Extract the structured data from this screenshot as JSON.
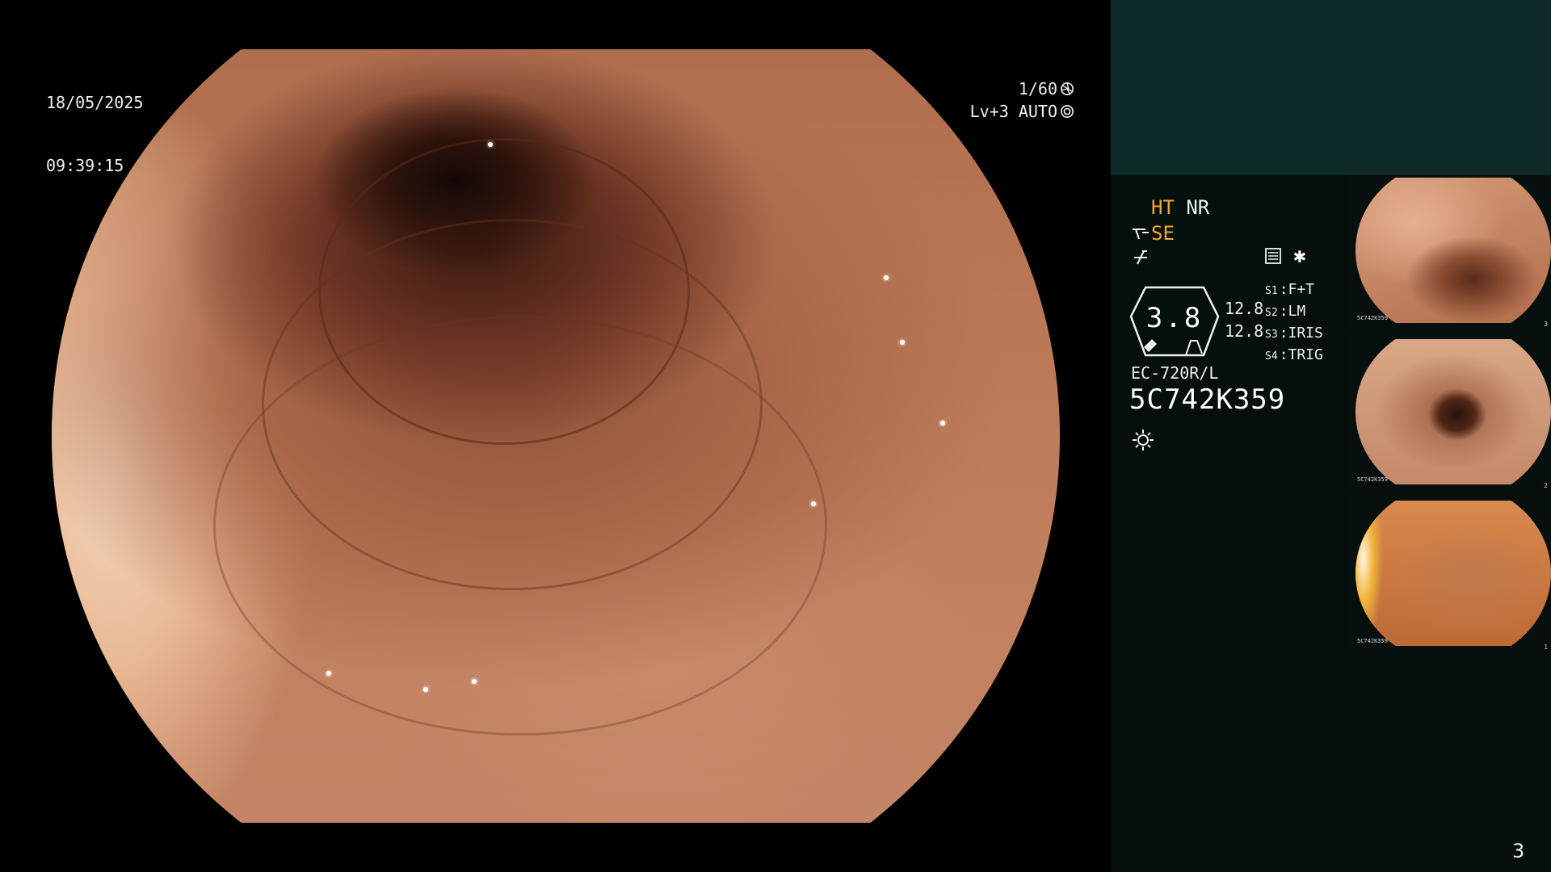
{
  "osd": {
    "date": "18/05/2025",
    "time": "09:39:15",
    "shutter": "1/60",
    "level": "Lv+3 AUTO"
  },
  "modes": {
    "ht": "HT",
    "nr": "NR",
    "se": "SE"
  },
  "gauge": {
    "value": "3.8",
    "num_top": "12.8",
    "num_bottom": "12.8"
  },
  "settings": [
    {
      "key": "S1",
      "value": "F+T"
    },
    {
      "key": "S2",
      "value": "LM"
    },
    {
      "key": "S3",
      "value": "IRIS"
    },
    {
      "key": "S4",
      "value": "TRIG"
    }
  ],
  "scope": {
    "model": "EC-720R/L",
    "serial": "5C742K359"
  },
  "thumbnails": [
    {
      "number": "3",
      "serial": "5C742K359"
    },
    {
      "number": "2",
      "serial": "5C742K359"
    },
    {
      "number": "1",
      "serial": "5C742K359"
    }
  ],
  "page_number": "3",
  "colors": {
    "accent_amber": "#f2a82a",
    "panel_bg": "#050f0e",
    "panel_header": "#0d2a29"
  },
  "icons": [
    "shutter-icon",
    "auto-iris-icon",
    "enhance-icon",
    "freeze-icon",
    "memo-icon",
    "star-icon",
    "light-icon"
  ]
}
